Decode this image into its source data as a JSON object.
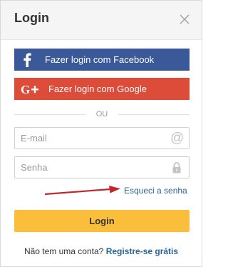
{
  "modal": {
    "title": "Login",
    "close_icon": "close-icon"
  },
  "social": {
    "facebook": {
      "label": "Fazer login com Facebook",
      "icon": "facebook-icon",
      "color": "#3b5998"
    },
    "google": {
      "label": "Fazer login com Google",
      "icon": "google-plus-icon",
      "color": "#dd4b39"
    }
  },
  "divider": {
    "label": "OU"
  },
  "form": {
    "email": {
      "placeholder": "E-mail",
      "value": "",
      "icon": "at-icon"
    },
    "password": {
      "placeholder": "Senha",
      "value": "",
      "icon": "lock-icon"
    },
    "forgot_label": "Esqueci a senha",
    "submit_label": "Login",
    "submit_color": "#fbbe3b"
  },
  "footer": {
    "prompt": "Não tem uma conta?",
    "register_label": "Registre-se grátis",
    "link_color": "#2a6496"
  }
}
